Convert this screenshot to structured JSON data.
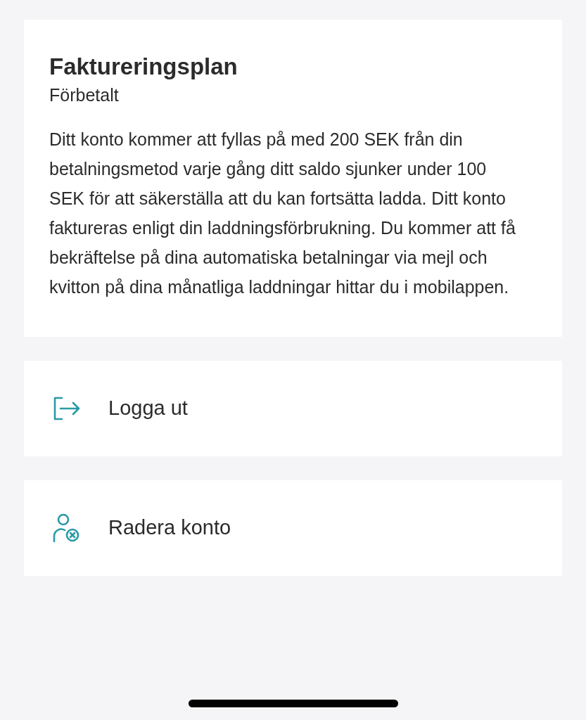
{
  "billing_card": {
    "title": "Faktureringsplan",
    "subtitle": "Förbetalt",
    "description": "Ditt konto kommer att fyllas på med 200 SEK från din betalningsmetod varje gång ditt saldo sjunker under 100 SEK för att säkerställa att du kan fortsätta ladda. Ditt konto faktureras enligt din laddningsförbrukning. Du kommer att få bekräftelse på dina automatiska betalningar via mejl och kvitton på dina månatliga laddningar hittar du i mobilappen."
  },
  "actions": [
    {
      "kind": "logout",
      "label": "Logga ut"
    },
    {
      "kind": "delete_account",
      "label": "Radera konto"
    }
  ]
}
